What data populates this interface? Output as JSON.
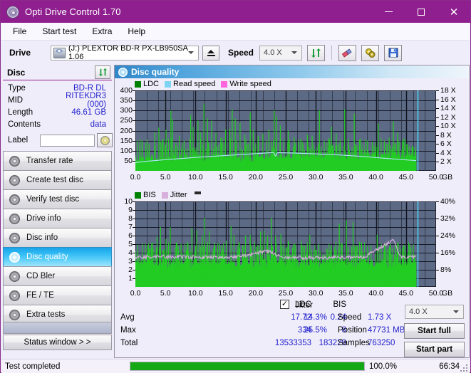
{
  "window": {
    "title": "Opti Drive Control 1.70",
    "icon": "disc-icon",
    "minimize": "minimize-icon",
    "maximize": "maximize-icon",
    "close": "close-icon"
  },
  "menu": {
    "items": [
      "File",
      "Start test",
      "Extra",
      "Help"
    ]
  },
  "toolbar": {
    "drive_label": "Drive",
    "drive_value": "(J:)  PLEXTOR BD-R  PX-LB950SA 1.06",
    "eject": "eject-icon",
    "speed_label": "Speed",
    "speed_value": "4.0 X",
    "refresh": "refresh-icon",
    "erase": "eraser-icon",
    "tools": "tools-icon",
    "save": "save-icon"
  },
  "disc": {
    "header": "Disc",
    "refresh": "refresh-icon",
    "rows": [
      {
        "key": "Type",
        "value": "BD-R DL"
      },
      {
        "key": "MID",
        "value": "RITEKDR3 (000)"
      },
      {
        "key": "Length",
        "value": "46.61 GB"
      },
      {
        "key": "Contents",
        "value": "data"
      }
    ],
    "label_key": "Label",
    "label_value": "",
    "label_button": "disc-label-icon"
  },
  "nav": {
    "items": [
      {
        "label": "Transfer rate",
        "active": false
      },
      {
        "label": "Create test disc",
        "active": false
      },
      {
        "label": "Verify test disc",
        "active": false
      },
      {
        "label": "Drive info",
        "active": false
      },
      {
        "label": "Disc info",
        "active": false
      },
      {
        "label": "Disc quality",
        "active": true
      },
      {
        "label": "CD Bler",
        "active": false
      },
      {
        "label": "FE / TE",
        "active": false
      },
      {
        "label": "Extra tests",
        "active": false
      }
    ],
    "status_window": "Status window > >"
  },
  "panel": {
    "title": "Disc quality",
    "icon": "disc-quality-icon"
  },
  "chart_data": [
    {
      "type": "area",
      "name": "ldc-chart",
      "title": "",
      "xlabel": "GB",
      "ylabel": "",
      "legend": [
        {
          "label": "LDC",
          "color": "#008000"
        },
        {
          "label": "Read speed",
          "color": "#7fd4f4"
        },
        {
          "label": "Write speed",
          "color": "#ff66e0"
        }
      ],
      "legend_position": "top-left",
      "grid": true,
      "xlim": [
        0,
        50
      ],
      "xticks": [
        "0.0",
        "5.0",
        "10.0",
        "15.0",
        "20.0",
        "25.0",
        "30.0",
        "35.0",
        "40.0",
        "45.0",
        "50.0"
      ],
      "x_unit": "GB",
      "ylim": [
        0,
        400
      ],
      "yticks": [
        50,
        100,
        150,
        200,
        250,
        300,
        350,
        400
      ],
      "y2lim": [
        0,
        18
      ],
      "y2ticks": [
        "2 X",
        "4 X",
        "6 X",
        "8 X",
        "10 X",
        "12 X",
        "14 X",
        "16 X",
        "18 X"
      ],
      "series": [
        {
          "name": "LDC",
          "color": "#22cc22",
          "baseline": 60,
          "noise": 40,
          "spikes": [
            {
              "x": 1.1,
              "y": 150
            },
            {
              "x": 2.3,
              "y": 135
            },
            {
              "x": 3.2,
              "y": 190
            },
            {
              "x": 3.9,
              "y": 215
            },
            {
              "x": 4.6,
              "y": 160
            },
            {
              "x": 5.1,
              "y": 205
            },
            {
              "x": 5.9,
              "y": 300
            },
            {
              "x": 6.2,
              "y": 258
            },
            {
              "x": 7.3,
              "y": 175
            },
            {
              "x": 8.1,
              "y": 150
            },
            {
              "x": 9.2,
              "y": 278
            },
            {
              "x": 9.6,
              "y": 218
            },
            {
              "x": 10.4,
              "y": 250
            },
            {
              "x": 10.8,
              "y": 192
            },
            {
              "x": 11.4,
              "y": 334
            },
            {
              "x": 12.0,
              "y": 260
            },
            {
              "x": 12.7,
              "y": 250
            },
            {
              "x": 13.4,
              "y": 190
            },
            {
              "x": 14.2,
              "y": 165
            },
            {
              "x": 15.0,
              "y": 205
            },
            {
              "x": 15.7,
              "y": 210
            },
            {
              "x": 16.1,
              "y": 305
            },
            {
              "x": 16.6,
              "y": 260
            },
            {
              "x": 17.4,
              "y": 240
            },
            {
              "x": 18.2,
              "y": 180
            },
            {
              "x": 19.1,
              "y": 290
            },
            {
              "x": 19.6,
              "y": 205
            },
            {
              "x": 20.4,
              "y": 175
            },
            {
              "x": 21.2,
              "y": 186
            },
            {
              "x": 22.2,
              "y": 205
            },
            {
              "x": 23.1,
              "y": 300
            },
            {
              "x": 23.5,
              "y": 270
            },
            {
              "x": 24.1,
              "y": 225
            },
            {
              "x": 25.4,
              "y": 200
            },
            {
              "x": 26.4,
              "y": 170
            },
            {
              "x": 27.5,
              "y": 160
            },
            {
              "x": 28.6,
              "y": 180
            },
            {
              "x": 29.4,
              "y": 175
            },
            {
              "x": 30.6,
              "y": 300
            },
            {
              "x": 31.4,
              "y": 150
            },
            {
              "x": 32.6,
              "y": 220
            },
            {
              "x": 33.4,
              "y": 185
            },
            {
              "x": 34.8,
              "y": 305
            },
            {
              "x": 35.4,
              "y": 160
            },
            {
              "x": 36.4,
              "y": 285
            },
            {
              "x": 37.3,
              "y": 155
            },
            {
              "x": 38.6,
              "y": 150
            },
            {
              "x": 39.4,
              "y": 145
            },
            {
              "x": 40.4,
              "y": 235
            },
            {
              "x": 41.4,
              "y": 150
            },
            {
              "x": 42.2,
              "y": 165
            },
            {
              "x": 42.9,
              "y": 245
            },
            {
              "x": 43.6,
              "y": 190
            },
            {
              "x": 44.4,
              "y": 150
            },
            {
              "x": 45.3,
              "y": 130
            },
            {
              "x": 46.2,
              "y": 120
            }
          ]
        },
        {
          "name": "Read speed",
          "color": "#aee6f8",
          "points": [
            {
              "x": 0.0,
              "y": 1.85
            },
            {
              "x": 2.0,
              "y": 2.15
            },
            {
              "x": 5.0,
              "y": 2.5
            },
            {
              "x": 8.0,
              "y": 2.8
            },
            {
              "x": 11.0,
              "y": 3.1
            },
            {
              "x": 14.0,
              "y": 3.35
            },
            {
              "x": 17.0,
              "y": 3.6
            },
            {
              "x": 20.0,
              "y": 3.85
            },
            {
              "x": 23.0,
              "y": 4.1
            },
            {
              "x": 23.3,
              "y": 3.2
            },
            {
              "x": 23.6,
              "y": 4.05
            },
            {
              "x": 26.0,
              "y": 4.0
            },
            {
              "x": 30.0,
              "y": 3.8
            },
            {
              "x": 34.0,
              "y": 3.55
            },
            {
              "x": 38.0,
              "y": 3.2
            },
            {
              "x": 42.0,
              "y": 2.75
            },
            {
              "x": 45.0,
              "y": 2.45
            },
            {
              "x": 46.7,
              "y": 2.3
            }
          ]
        }
      ],
      "marker_line": {
        "x": 46.9,
        "color": "#4bc8f0"
      },
      "data_end_x": 46.7
    },
    {
      "type": "area",
      "name": "bis-jitter-chart",
      "title": "",
      "xlabel": "GB",
      "legend": [
        {
          "label": "BIS",
          "color": "#008000"
        },
        {
          "label": "Jitter",
          "color": "#d8b0dd"
        }
      ],
      "legend_position": "top-left",
      "grid": true,
      "xlim": [
        0,
        50
      ],
      "xticks": [
        "0.0",
        "5.0",
        "10.0",
        "15.0",
        "20.0",
        "25.0",
        "30.0",
        "35.0",
        "40.0",
        "45.0",
        "50.0"
      ],
      "x_unit": "GB",
      "ylim": [
        0,
        10
      ],
      "yticks": [
        1,
        2,
        3,
        4,
        5,
        6,
        7,
        8,
        9,
        10
      ],
      "y2lim": [
        0,
        40
      ],
      "y2ticks": [
        "8%",
        "16%",
        "24%",
        "32%",
        "40%"
      ],
      "series": [
        {
          "name": "BIS",
          "color": "#22cc22",
          "baseline": 2.6,
          "noise": 1.1,
          "spikes": [
            {
              "x": 2.9,
              "y": 5.2
            },
            {
              "x": 3.6,
              "y": 5.9
            },
            {
              "x": 4.2,
              "y": 7.0
            },
            {
              "x": 5.1,
              "y": 5.6
            },
            {
              "x": 5.8,
              "y": 7.0
            },
            {
              "x": 6.8,
              "y": 5.2
            },
            {
              "x": 7.6,
              "y": 5.0
            },
            {
              "x": 8.6,
              "y": 5.3
            },
            {
              "x": 9.4,
              "y": 6.9
            },
            {
              "x": 10.2,
              "y": 6.6
            },
            {
              "x": 11.1,
              "y": 6.0
            },
            {
              "x": 11.5,
              "y": 8.1
            },
            {
              "x": 12.3,
              "y": 6.5
            },
            {
              "x": 13.1,
              "y": 5.2
            },
            {
              "x": 14.0,
              "y": 5.0
            },
            {
              "x": 15.1,
              "y": 5.4
            },
            {
              "x": 15.9,
              "y": 7.1
            },
            {
              "x": 16.4,
              "y": 6.1
            },
            {
              "x": 17.2,
              "y": 5.2
            },
            {
              "x": 18.3,
              "y": 6.0
            },
            {
              "x": 19.1,
              "y": 6.1
            },
            {
              "x": 19.8,
              "y": 5.3
            },
            {
              "x": 20.8,
              "y": 6.5
            },
            {
              "x": 21.4,
              "y": 6.5
            },
            {
              "x": 22.0,
              "y": 6.0
            },
            {
              "x": 22.6,
              "y": 8.1
            },
            {
              "x": 23.3,
              "y": 6.0
            },
            {
              "x": 24.2,
              "y": 6.2
            },
            {
              "x": 25.4,
              "y": 5.4
            },
            {
              "x": 26.3,
              "y": 5.0
            },
            {
              "x": 27.6,
              "y": 5.4
            },
            {
              "x": 29.0,
              "y": 6.1
            },
            {
              "x": 30.5,
              "y": 5.0
            },
            {
              "x": 32.6,
              "y": 4.9
            },
            {
              "x": 33.9,
              "y": 7.4
            },
            {
              "x": 35.1,
              "y": 7.8
            },
            {
              "x": 36.2,
              "y": 7.6
            },
            {
              "x": 37.6,
              "y": 5.1
            },
            {
              "x": 38.6,
              "y": 4.8
            },
            {
              "x": 40.2,
              "y": 6.1
            },
            {
              "x": 41.4,
              "y": 5.0
            },
            {
              "x": 42.4,
              "y": 5.0
            },
            {
              "x": 43.6,
              "y": 5.2
            },
            {
              "x": 44.6,
              "y": 4.9
            },
            {
              "x": 45.6,
              "y": 5.0
            }
          ]
        },
        {
          "name": "Jitter",
          "color": "#d8b0dd",
          "baseline_pct": 14.0,
          "points": [
            {
              "x": 0.0,
              "y": 13.8
            },
            {
              "x": 4.0,
              "y": 14.2
            },
            {
              "x": 8.0,
              "y": 14.0
            },
            {
              "x": 12.0,
              "y": 13.8
            },
            {
              "x": 16.0,
              "y": 14.0
            },
            {
              "x": 18.5,
              "y": 14.6
            },
            {
              "x": 20.5,
              "y": 16.0
            },
            {
              "x": 21.8,
              "y": 16.8
            },
            {
              "x": 22.8,
              "y": 16.2
            },
            {
              "x": 24.0,
              "y": 14.0
            },
            {
              "x": 28.0,
              "y": 13.6
            },
            {
              "x": 33.0,
              "y": 13.8
            },
            {
              "x": 38.0,
              "y": 13.9
            },
            {
              "x": 42.9,
              "y": 22.0
            },
            {
              "x": 44.0,
              "y": 14.2
            },
            {
              "x": 46.7,
              "y": 13.9
            }
          ]
        }
      ],
      "marker_line": {
        "x": 46.9,
        "color": "#4bc8f0"
      },
      "data_end_x": 46.7
    }
  ],
  "stats": {
    "col_headers": [
      "LDC",
      "BIS"
    ],
    "rows": [
      {
        "key": "Avg",
        "ldc": "17.72",
        "bis": "0.24"
      },
      {
        "key": "Max",
        "ldc": "334",
        "bis": "8"
      },
      {
        "key": "Total",
        "ldc": "13533353",
        "bis": "183229"
      }
    ],
    "jitter_label": "Jitter",
    "jitter_checked": true,
    "jitter_avg": "14.3%",
    "jitter_max": "25.5%",
    "speed_key": "Speed",
    "speed_value": "1.73 X",
    "position_key": "Position",
    "position_value": "47731 MB",
    "samples_key": "Samples",
    "samples_value": "763250",
    "speed_select": "4.0 X",
    "start_full": "Start full",
    "start_part": "Start part"
  },
  "statusbar": {
    "message": "Test completed",
    "progress_pct": 100.0,
    "progress_text": "100.0%",
    "elapsed": "66:34"
  },
  "colors": {
    "accent": "#8f1f8f",
    "chart_bg": "#5d6a85",
    "green": "#22cc22",
    "cyan": "#4bc8f0",
    "pink": "#d8b0dd",
    "value_blue": "#2222cc"
  }
}
